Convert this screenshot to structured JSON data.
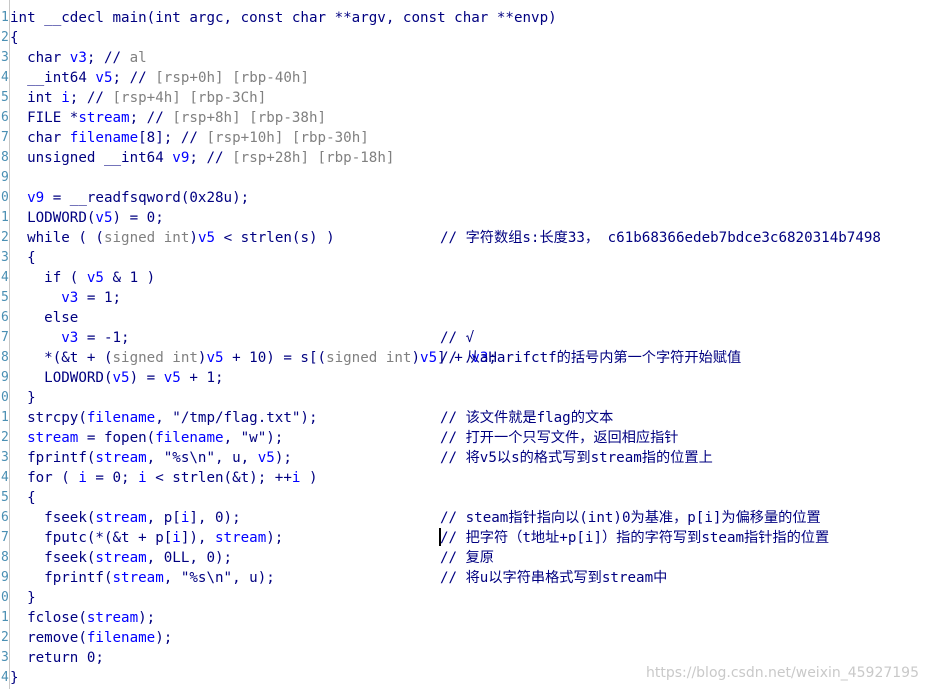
{
  "editor": {
    "line_numbers": [
      "1",
      "2",
      "3",
      "4",
      "5",
      "6",
      "7",
      "8",
      "9",
      "0",
      "1",
      "2",
      "3",
      "4",
      "5",
      "6",
      "7",
      "8",
      "9",
      "0",
      "1",
      "2",
      "3",
      "4",
      "5",
      "6",
      "7",
      "8",
      "9",
      "0",
      "1",
      "2",
      "3",
      "4"
    ],
    "lines": [
      {
        "code": "int __cdecl main(int argc, const char **argv, const char **envp)",
        "comment": ""
      },
      {
        "code": "{",
        "comment": ""
      },
      {
        "code": "  char v3; // al",
        "comment": ""
      },
      {
        "code": "  __int64 v5; // [rsp+0h] [rbp-40h]",
        "comment": ""
      },
      {
        "code": "  int i; // [rsp+4h] [rbp-3Ch]",
        "comment": ""
      },
      {
        "code": "  FILE *stream; // [rsp+8h] [rbp-38h]",
        "comment": ""
      },
      {
        "code": "  char filename[8]; // [rsp+10h] [rbp-30h]",
        "comment": ""
      },
      {
        "code": "  unsigned __int64 v9; // [rsp+28h] [rbp-18h]",
        "comment": ""
      },
      {
        "code": "",
        "comment": ""
      },
      {
        "code": "  v9 = __readfsqword(0x28u);",
        "comment": ""
      },
      {
        "code": "  LODWORD(v5) = 0;",
        "comment": ""
      },
      {
        "code": "  while ( (signed int)v5 < strlen(s) )",
        "comment": "// 字符数组s:长度33， c61b68366edeb7bdce3c6820314b7498"
      },
      {
        "code": "  {",
        "comment": ""
      },
      {
        "code": "    if ( v5 & 1 )",
        "comment": ""
      },
      {
        "code": "      v3 = 1;",
        "comment": ""
      },
      {
        "code": "    else",
        "comment": ""
      },
      {
        "code": "      v3 = -1;",
        "comment": "// √"
      },
      {
        "code": "    *(&t + (signed int)v5 + 10) = s[(signed int)v5] + v3;",
        "comment": "// 从aHarifctf的括号内第一个字符开始赋值"
      },
      {
        "code": "    LODWORD(v5) = v5 + 1;",
        "comment": ""
      },
      {
        "code": "  }",
        "comment": ""
      },
      {
        "code": "  strcpy(filename, \"/tmp/flag.txt\");",
        "comment": "// 该文件就是flag的文本"
      },
      {
        "code": "  stream = fopen(filename, \"w\");",
        "comment": "// 打开一个只写文件，返回相应指针"
      },
      {
        "code": "  fprintf(stream, \"%s\\n\", u, v5);",
        "comment": "// 将v5以s的格式写到stream指的位置上"
      },
      {
        "code": "  for ( i = 0; i < strlen(&t); ++i )",
        "comment": ""
      },
      {
        "code": "  {",
        "comment": ""
      },
      {
        "code": "    fseek(stream, p[i], 0);",
        "comment": "// steam指针指向以(int)0为基准，p[i]为偏移量的位置"
      },
      {
        "code": "    fputc(*(&t + p[i]), stream);",
        "comment": "// 把字符（t地址+p[i]）指的字符写到steam指针指的位置"
      },
      {
        "code": "    fseek(stream, 0LL, 0);",
        "comment": "// 复原"
      },
      {
        "code": "    fprintf(stream, \"%s\\n\", u);",
        "comment": "// 将u以字符串格式写到stream中"
      },
      {
        "code": "  }",
        "comment": ""
      },
      {
        "code": "  fclose(stream);",
        "comment": ""
      },
      {
        "code": "  remove(filename);",
        "comment": ""
      },
      {
        "code": "  return 0;",
        "comment": ""
      },
      {
        "code": "}",
        "comment": ""
      }
    ]
  },
  "watermark": "https://blog.csdn.net/weixin_45927195",
  "colors": {
    "keyword": "#000080",
    "variable": "#0000ff",
    "gray_annotation": "#808080",
    "line_number": "#4a8fb3"
  }
}
